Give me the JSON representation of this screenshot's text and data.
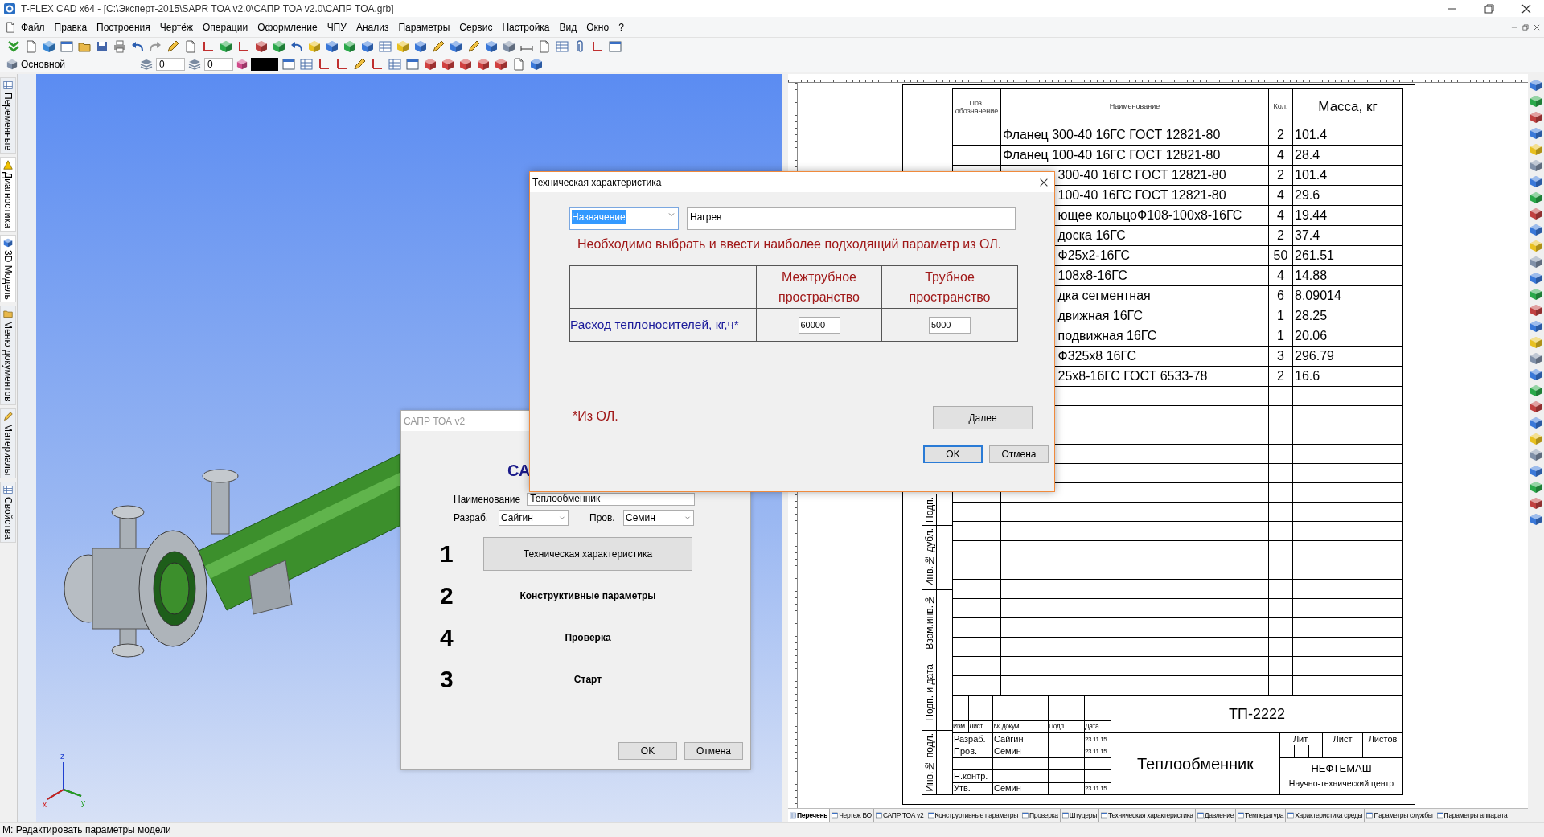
{
  "window": {
    "title": "T-FLEX CAD x64 - [C:\\Эксперт-2015\\SAPR TOA v2.0\\САПР TOA v2.0\\САПР TOA.grb]"
  },
  "menu": [
    "Файл",
    "Правка",
    "Построения",
    "Чертёж",
    "Операции",
    "Оформление",
    "ЧПУ",
    "Анализ",
    "Параметры",
    "Сервис",
    "Настройка",
    "Вид",
    "Окно",
    "?"
  ],
  "style_bar": {
    "style": "Основной",
    "layer": "0",
    "level": "0"
  },
  "side_tabs": [
    {
      "label": "Переменные",
      "selected": false
    },
    {
      "label": "Диагностика",
      "selected": true
    },
    {
      "label": "3D Модель",
      "selected": true
    },
    {
      "label": "Меню документов",
      "selected": false
    },
    {
      "label": "Материалы",
      "selected": false
    },
    {
      "label": "Свойства",
      "selected": false
    }
  ],
  "axis_labels": [
    "z",
    "x",
    "y"
  ],
  "specification": {
    "columns": [
      "Поз. обозначение",
      "Наименование",
      "Кол.",
      "Масса, кг"
    ],
    "rows": [
      {
        "name": "Фланец  300-40 16ГС ГОСТ 12821-80",
        "qty": "2",
        "mass": "101.4"
      },
      {
        "name": "Фланец  100-40 16ГС ГОСТ 12821-80",
        "qty": "4",
        "mass": "28.4"
      },
      {
        "name": "300-40 16ГС ГОСТ 12821-80",
        "qty": "2",
        "mass": "101.4"
      },
      {
        "name": "100-40 16ГС ГОСТ 12821-80",
        "qty": "4",
        "mass": "29.6"
      },
      {
        "name": "ющее кольцоФ108-100х8-16ГС",
        "qty": "4",
        "mass": "19.44"
      },
      {
        "name": "доска 16ГС",
        "qty": "2",
        "mass": "37.4"
      },
      {
        "name": "Ф25х2-16ГС",
        "qty": "50",
        "mass": "261.51"
      },
      {
        "name": "108х8-16ГС",
        "qty": "4",
        "mass": "14.88"
      },
      {
        "name": "дка сегментная",
        "qty": "6",
        "mass": "8.09014"
      },
      {
        "name": "движная 16ГС",
        "qty": "1",
        "mass": "28.25"
      },
      {
        "name": "подвижная 16ГС",
        "qty": "1",
        "mass": "20.06"
      },
      {
        "name": "Ф325х8 16ГС",
        "qty": "3",
        "mass": "296.79"
      },
      {
        "name": "25х8-16ГС ГОСТ 6533-78",
        "qty": "2",
        "mass": "16.6"
      }
    ]
  },
  "side_stamp": [
    "Подп.",
    "Инв.№ дубл.",
    "Взам.инв.№",
    "Подп. и дата",
    "Инв.№ подл."
  ],
  "title_block": {
    "doc_number": "ТП-2222",
    "header": [
      "Изм.",
      "Лист",
      "№ докум.",
      "Подп.",
      "Дата"
    ],
    "signatures": [
      {
        "role": "Разраб.",
        "name": "Сайгин",
        "date": "23.11.15"
      },
      {
        "role": "Пров.",
        "name": "Семин",
        "date": "23.11.15"
      },
      {
        "role": "Н.контр."
      },
      {
        "role": "Утв.",
        "name": "Семин",
        "date": "23.11.15"
      }
    ],
    "title": "Теплообменник",
    "sheet_headers": [
      "Лит.",
      "Лист",
      "Листов"
    ],
    "organization": "НЕФТЕМАШ",
    "organization_sub": "Научно-технический центр"
  },
  "sheet_tabs": [
    {
      "label": "Перечень",
      "selected": true
    },
    {
      "label": "Чертеж ВО",
      "selected": false
    },
    {
      "label": "САПР ТОА v2",
      "selected": false
    },
    {
      "label": "Конструртивные параметры",
      "selected": false
    },
    {
      "label": "Проверка",
      "selected": false
    },
    {
      "label": "Штуцеры",
      "selected": false
    },
    {
      "label": "Техническая характеристика",
      "selected": false
    },
    {
      "label": "Давление",
      "selected": false
    },
    {
      "label": "Температура",
      "selected": false
    },
    {
      "label": "Характеристика среды",
      "selected": false
    },
    {
      "label": "Параметры службы",
      "selected": false
    },
    {
      "label": "Параметры аппарата",
      "selected": false
    }
  ],
  "sapr_dialog": {
    "title": "САПР ТОА v2",
    "heading": "СА",
    "name_label": "Наименование",
    "name_value": "Теплообменник",
    "developer_label": "Разраб.",
    "developer": "Сайгин",
    "checker_label": "Пров.",
    "checker": "Семин",
    "steps": [
      {
        "number": "1",
        "label": "Техническая характеристика",
        "kind": "button"
      },
      {
        "number": "2",
        "label": "Конструктивные параметры",
        "kind": "text"
      },
      {
        "number": "4",
        "label": "Проверка",
        "kind": "text"
      },
      {
        "number": "3",
        "label": "Старт",
        "kind": "text"
      }
    ],
    "buttons": [
      "OK",
      "Отмена"
    ]
  },
  "tech_dialog": {
    "title": "Техническая характеристика",
    "purpose": "Назначение",
    "purpose_value": "Нагрев",
    "message": "Необходимо выбрать и ввести наиболее подходящий параметр из ОЛ.",
    "columns": [
      "Межтрубное пространство",
      "Трубное пространство"
    ],
    "row_label": "Расход теплоносителей, кг,ч*",
    "values": [
      "60000",
      "5000"
    ],
    "note": "*Из ОЛ.",
    "next_button": "Далее",
    "buttons": [
      "OK",
      "Отмена"
    ]
  },
  "status_bar": "М: Редактировать параметры модели"
}
